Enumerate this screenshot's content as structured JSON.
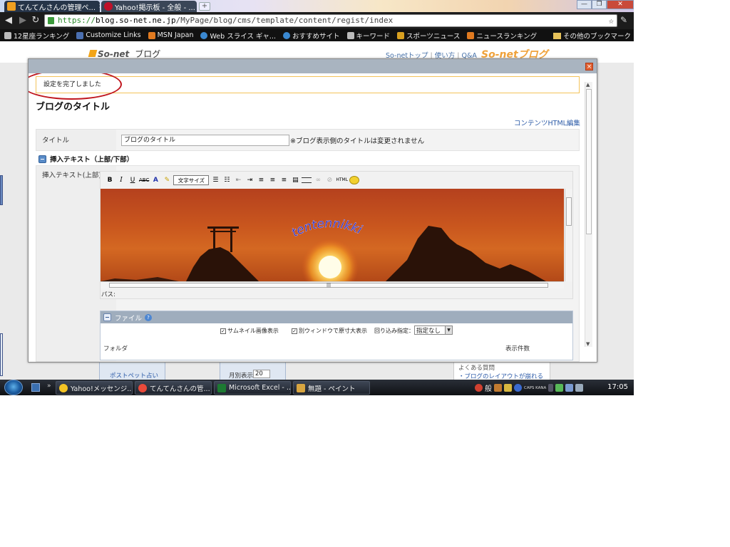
{
  "browser": {
    "tabs": [
      {
        "label": "てんてんさんの管理ペ...",
        "close": "×"
      },
      {
        "label": "Yahoo!掲示板 - 全般 - ...",
        "close": "×"
      }
    ],
    "new_tab": "+",
    "window_buttons": {
      "minimize": "—",
      "restore": "❐",
      "close": "✕"
    },
    "address": {
      "scheme": "https://",
      "host": "blog.so-net.ne.jp",
      "path": "/MyPage/blog/cms/template/content/regist/index"
    },
    "star": "☆",
    "wrench": "🔧",
    "bookmarks": [
      "12星座ランキング",
      "Customize Links",
      "MSN Japan",
      "Web スライス ギャ...",
      "おすすめサイト",
      "キーワード",
      "スポーツニュース",
      "ニュースランキング"
    ],
    "other_bookmarks": "その他のブックマーク"
  },
  "page": {
    "logo": "So-net",
    "logo_sub": "ブログ",
    "header_links": [
      "So-netトップ",
      "使い方",
      "Q&A"
    ],
    "brand": "So-netブログ",
    "under": {
      "box1": "ポストペット占い",
      "box2_label": "月別表示",
      "box2_value": "20",
      "faq_title": "よくある質問",
      "faq_link": "・ブログのレイアウトが崩れる"
    }
  },
  "modal": {
    "close": "×",
    "notice": "設定を完了しました",
    "title": "ブログのタイトル",
    "html_link": "コンテンツHTML編集",
    "title_row": {
      "label": "タイトル",
      "value": "ブログのタイトル",
      "note": "※ブログ表示側のタイトルは変更されません"
    },
    "insert_section": "挿入テキスト（上部/下部）",
    "insert_label": "挿入テキスト(上部)",
    "editor": {
      "tools": [
        "B",
        "I",
        "U",
        "ABC",
        "A",
        "文字サイズ",
        "HTML"
      ],
      "image_text": "tentennikki",
      "path_label": "パス:"
    },
    "file_panel": {
      "title": "ファイル",
      "help": "?",
      "opt_thumbnail": "サムネイル画像表示",
      "opt_newwindow": "別ウィンドウで原寸大表示",
      "wrap_label": "回り込み指定：",
      "wrap_value": "指定なし",
      "cut_left": "フォルダ",
      "cut_right": "表示件数"
    }
  },
  "taskbar": {
    "ql_more": "»",
    "tasks": [
      "Yahoo!メッセンジ...",
      "てんてんさんの管...",
      "Microsoft Excel - ...",
      "無題 - ペイント"
    ],
    "ime": "般",
    "caps": "CAPS KANA",
    "clock": "17:05"
  }
}
